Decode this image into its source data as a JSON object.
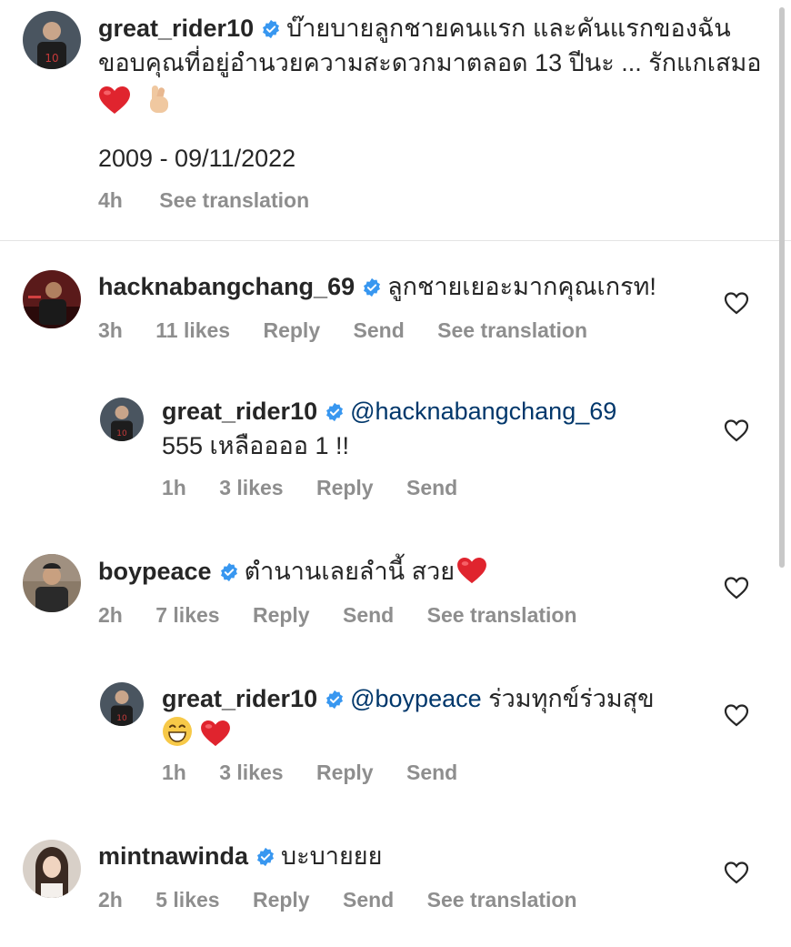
{
  "caption": {
    "username": "great_rider10",
    "text_line1": "บ๊ายบายลูกชายคนแรก และคันแรกของฉัน",
    "text_line2": "ขอบคุณที่อยู่อำนวยความสะดวกมาตลอด 13 ปีนะ ... รักแกเสมอ",
    "date_line": "2009 - 09/11/2022",
    "time": "4h",
    "see_translation": "See translation"
  },
  "comments": [
    {
      "username": "hacknabangchang_69",
      "text": "ลูกชายเยอะมากคุณเกรท!",
      "time": "3h",
      "likes": "11 likes",
      "reply": "Reply",
      "send": "Send",
      "see_translation": "See translation"
    },
    {
      "username": "great_rider10",
      "mention": "@hacknabangchang_69",
      "text": "555 เหลืออออ 1 !!",
      "time": "1h",
      "likes": "3 likes",
      "reply": "Reply",
      "send": "Send"
    },
    {
      "username": "boypeace",
      "text": "ตำนานเลยลำนี้ สวย",
      "time": "2h",
      "likes": "7 likes",
      "reply": "Reply",
      "send": "Send",
      "see_translation": "See translation"
    },
    {
      "username": "great_rider10",
      "mention": "@boypeace",
      "text": "ร่วมทุกข์ร่วมสุข",
      "time": "1h",
      "likes": "3 likes",
      "reply": "Reply",
      "send": "Send"
    },
    {
      "username": "mintnawinda",
      "text": "บะบายยย",
      "time": "2h",
      "likes": "5 likes",
      "reply": "Reply",
      "send": "Send",
      "see_translation": "See translation"
    }
  ],
  "colors": {
    "text": "#262626",
    "meta": "#8e8e8e",
    "mention": "#00376b",
    "verified": "#3897f0",
    "heart_emoji": "#e0242e"
  }
}
